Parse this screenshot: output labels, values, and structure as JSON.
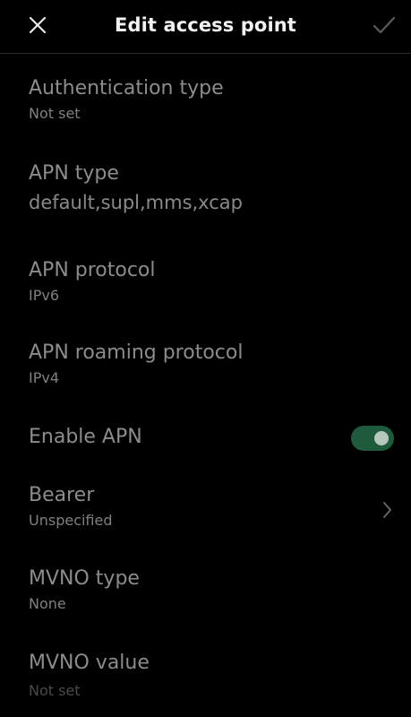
{
  "header": {
    "title": "Edit access point",
    "close_icon": "close-icon",
    "confirm_icon": "check-icon"
  },
  "settings": {
    "auth_type": {
      "label": "Authentication type",
      "value": "Not set"
    },
    "apn_type": {
      "label": "APN type",
      "value": "default,supl,mms,xcap"
    },
    "apn_protocol": {
      "label": "APN protocol",
      "value": "IPv6"
    },
    "apn_roaming_protocol": {
      "label": "APN roaming protocol",
      "value": "IPv4"
    },
    "enable_apn": {
      "label": "Enable APN",
      "enabled": true
    },
    "bearer": {
      "label": "Bearer",
      "value": "Unspecified"
    },
    "mvno_type": {
      "label": "MVNO type",
      "value": "None"
    },
    "mvno_value": {
      "label": "MVNO value",
      "value": "Not set"
    }
  },
  "colors": {
    "background": "#000000",
    "label": "#8c8c8c",
    "toggle_on": "#1e5b3c"
  }
}
